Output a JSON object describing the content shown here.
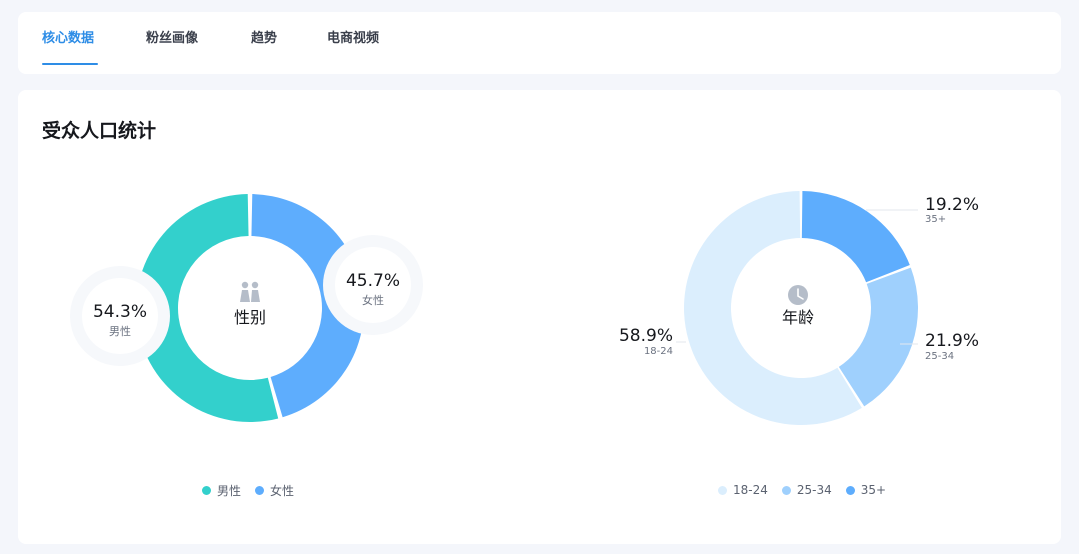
{
  "tabs": [
    {
      "label": "核心数据",
      "active": true
    },
    {
      "label": "粉丝画像",
      "active": false
    },
    {
      "label": "趋势",
      "active": false
    },
    {
      "label": "电商视频",
      "active": false
    }
  ],
  "section_title": "受众人口统计",
  "colors": {
    "accent": "#2e8de6",
    "male": "#33d0cc",
    "female": "#5eadfd",
    "age_18_24": "#dbeefd",
    "age_25_34": "#9fd0fd",
    "age_35_plus": "#5eadfd"
  },
  "chart_data": [
    {
      "type": "pie",
      "variant": "donut",
      "title": "性别",
      "center_icon": "people-icon",
      "categories": [
        "男性",
        "女性"
      ],
      "values": [
        54.3,
        45.7
      ],
      "labels": [
        "54.3%",
        "45.7%"
      ],
      "legend": [
        "男性",
        "女性"
      ],
      "legend_position": "bottom"
    },
    {
      "type": "pie",
      "variant": "donut",
      "title": "年龄",
      "center_icon": "clock-icon",
      "categories": [
        "18-24",
        "25-34",
        "35+"
      ],
      "values": [
        58.9,
        21.9,
        19.2
      ],
      "labels": [
        "58.9%",
        "21.9%",
        "19.2%"
      ],
      "segment_label_35": "35+",
      "legend": [
        "18-24",
        "25-34",
        "35+"
      ],
      "legend_position": "bottom"
    }
  ]
}
